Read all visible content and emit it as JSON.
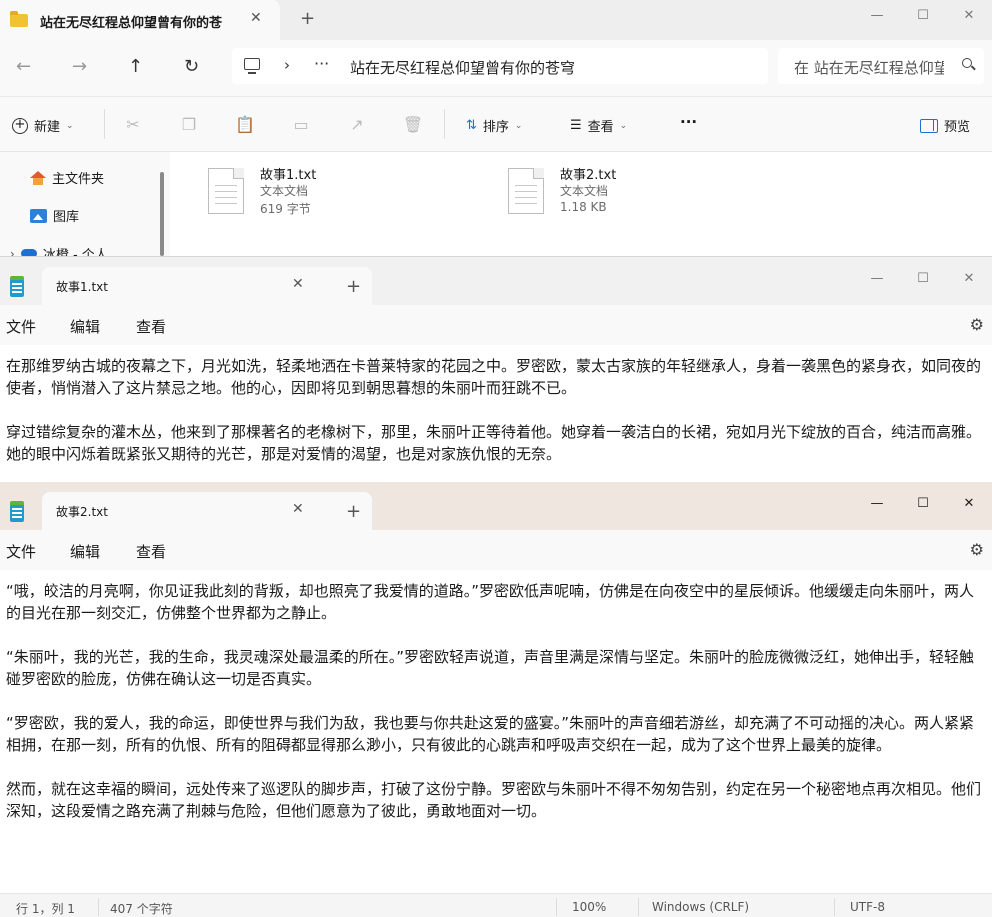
{
  "explorer": {
    "tab_title": "站在无尽红程总仰望曾有你的苍",
    "tab_close": "✕",
    "new_tab": "+",
    "nav": {
      "back": "←",
      "forward": "→",
      "up": "↑",
      "refresh": "↻"
    },
    "address": {
      "chevron": "›",
      "more": "···",
      "path": "站在无尽红程总仰望曾有你的苍穹"
    },
    "search_placeholder": "在 站在无尽红程总仰望曾有你的苍穹 中搜索",
    "window_controls": {
      "minimize": "—",
      "maximize": "☐",
      "close": "✕"
    },
    "commands": {
      "new_label": "新建",
      "sort_label": "排序",
      "view_label": "查看",
      "more_label": "···",
      "preview_label": "预览"
    },
    "sidebar": {
      "items": [
        {
          "label": "主文件夹"
        },
        {
          "label": "图库"
        },
        {
          "label": "冰橙 - 个人"
        }
      ]
    },
    "files": [
      {
        "name": "故事1.txt",
        "type": "文本文档",
        "size": "619 字节"
      },
      {
        "name": "故事2.txt",
        "type": "文本文档",
        "size": "1.18 KB"
      }
    ]
  },
  "notepad1": {
    "tab_title": "故事1.txt",
    "tab_close": "✕",
    "new_tab": "+",
    "window_controls": {
      "minimize": "—",
      "maximize": "☐",
      "close": "✕"
    },
    "menus": {
      "file": "文件",
      "edit": "编辑",
      "view": "查看"
    },
    "settings_icon": "⚙",
    "paragraphs": [
      "在那维罗纳古城的夜幕之下，月光如洗，轻柔地洒在卡普莱特家的花园之中。罗密欧，蒙太古家族的年轻继承人，身着一袭黑色的紧身衣，如同夜的使者，悄悄潜入了这片禁忌之地。他的心，因即将见到朝思暮想的朱丽叶而狂跳不已。",
      "穿过错综复杂的灌木丛，他来到了那棵著名的老橡树下，那里，朱丽叶正等待着他。她穿着一袭洁白的长裙，宛如月光下绽放的百合，纯洁而高雅。她的眼中闪烁着既紧张又期待的光芒，那是对爱情的渴望，也是对家族仇恨的无奈。"
    ]
  },
  "notepad2": {
    "tab_title": "故事2.txt",
    "tab_close": "✕",
    "new_tab": "+",
    "window_controls": {
      "minimize": "—",
      "maximize": "☐",
      "close": "✕"
    },
    "menus": {
      "file": "文件",
      "edit": "编辑",
      "view": "查看"
    },
    "settings_icon": "⚙",
    "paragraphs": [
      "“哦，皎洁的月亮啊，你见证我此刻的背叛，却也照亮了我爱情的道路。”罗密欧低声呢喃，仿佛是在向夜空中的星辰倾诉。他缓缓走向朱丽叶，两人的目光在那一刻交汇，仿佛整个世界都为之静止。",
      "“朱丽叶，我的光芒，我的生命，我灵魂深处最温柔的所在。”罗密欧轻声说道，声音里满是深情与坚定。朱丽叶的脸庞微微泛红，她伸出手，轻轻触碰罗密欧的脸庞，仿佛在确认这一切是否真实。",
      "“罗密欧，我的爱人，我的命运，即使世界与我们为敌，我也要与你共赴这爱的盛宴。”朱丽叶的声音细若游丝，却充满了不可动摇的决心。两人紧紧相拥，在那一刻，所有的仇恨、所有的阻碍都显得那么渺小，只有彼此的心跳声和呼吸声交织在一起，成为了这个世界上最美的旋律。",
      "然而，就在这幸福的瞬间，远处传来了巡逻队的脚步声，打破了这份宁静。罗密欧与朱丽叶不得不匆匆告别，约定在另一个秘密地点再次相见。他们深知，这段爱情之路充满了荆棘与危险，但他们愿意为了彼此，勇敢地面对一切。"
    ],
    "status": {
      "position": "行 1，列 1",
      "chars": "407 个字符",
      "zoom": "100%",
      "line_ending": "Windows (CRLF)",
      "encoding": "UTF-8"
    }
  }
}
